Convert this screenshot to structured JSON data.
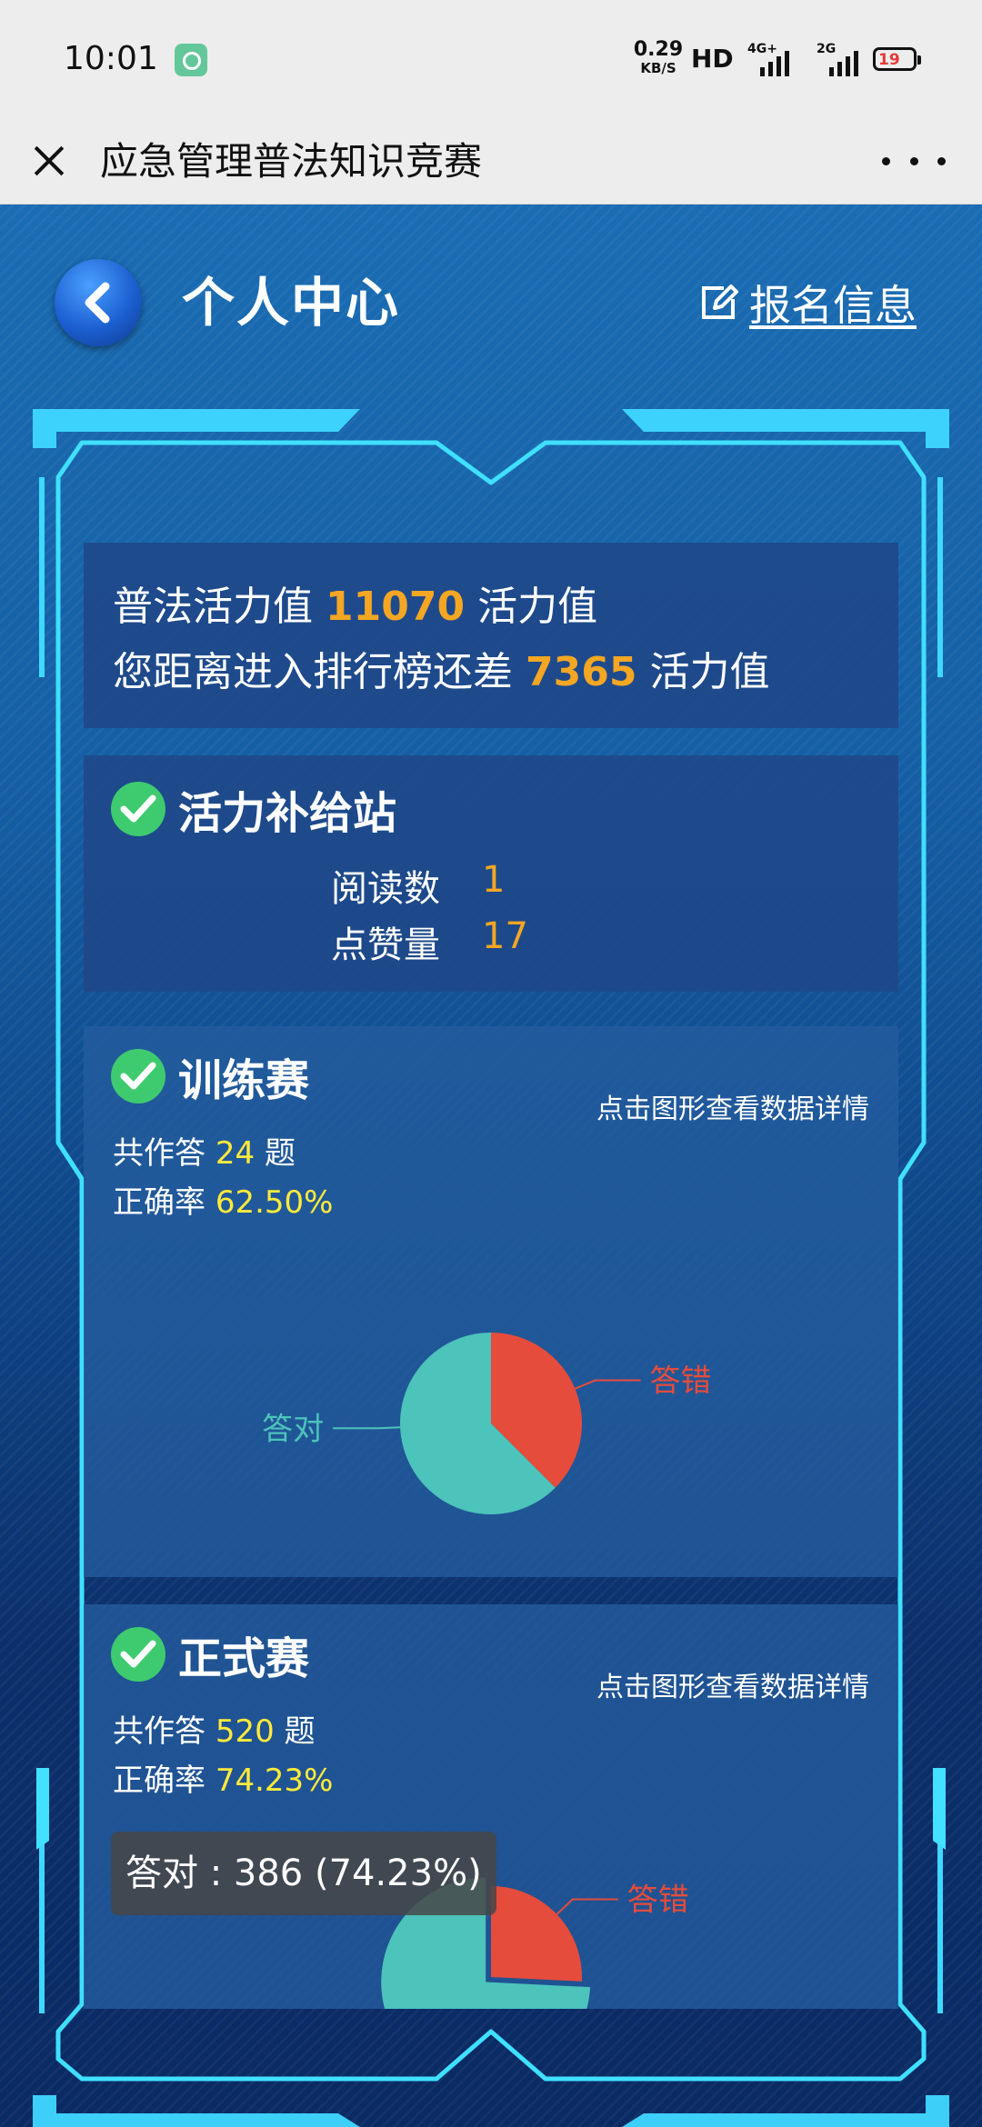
{
  "status_bar": {
    "time": "10:01",
    "net_speed_value": "0.29",
    "net_speed_unit": "KB/S",
    "hd_label": "HD",
    "sim1_label": "4G+",
    "sim2_label": "2G",
    "battery": "19"
  },
  "titlebar": {
    "title": "应急管理普法知识竞赛"
  },
  "header": {
    "title": "个人中心",
    "register_label": "报名信息"
  },
  "vitality": {
    "line1_prefix": "普法活力值",
    "value": "11070",
    "line1_suffix": "活力值",
    "line2_prefix": "您距离进入排行榜还差",
    "gap": "7365",
    "line2_suffix": "活力值"
  },
  "supply": {
    "title": "活力补给站",
    "reads_label": "阅读数",
    "reads_value": "1",
    "likes_label": "点赞量",
    "likes_value": "17"
  },
  "training": {
    "title": "训练赛",
    "hint": "点击图形查看数据详情",
    "total_prefix": "共作答",
    "total": "24",
    "total_suffix": "题",
    "accuracy_label": "正确率",
    "accuracy": "62.50%",
    "label_wrong": "答错",
    "label_right": "答对"
  },
  "formal": {
    "title": "正式赛",
    "hint": "点击图形查看数据详情",
    "total_prefix": "共作答",
    "total": "520",
    "total_suffix": "题",
    "accuracy_label": "正确率",
    "accuracy": "74.23%",
    "label_wrong": "答错",
    "tooltip": "答对 : 386 (74.23%)"
  },
  "colors": {
    "correct": "#4cc3bb",
    "wrong": "#e54c3c",
    "highlight": "#f5a623",
    "yellow": "#ffea3b"
  },
  "chart_data": [
    {
      "type": "pie",
      "categories": [
        "答对",
        "答错"
      ],
      "values": [
        15,
        9
      ]
    },
    {
      "type": "pie",
      "categories": [
        "答对",
        "答错"
      ],
      "values": [
        386,
        134
      ]
    }
  ]
}
